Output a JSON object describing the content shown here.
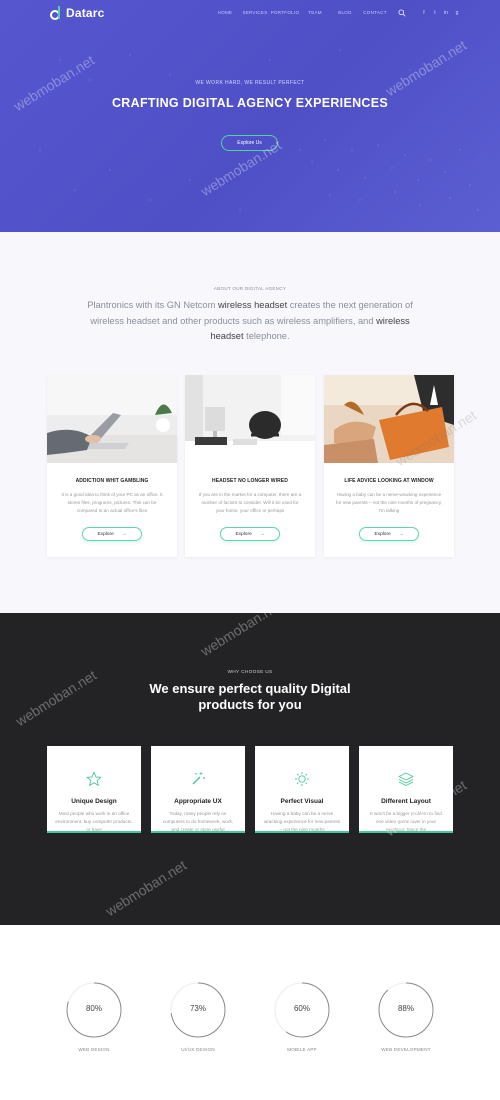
{
  "brand": {
    "name": "Datarc"
  },
  "nav": {
    "items": [
      "HOME",
      "SERVICES",
      "PORTFOLIO",
      "TEAM",
      "BLOG",
      "CONTACT"
    ]
  },
  "social": [
    "f",
    "t",
    "in",
    "g"
  ],
  "hero": {
    "kicker": "WE WORK HARD, WE RESULT PERFECT",
    "title": "CRAFTING DIGITAL AGENCY EXPERIENCES",
    "button": "Explore Us"
  },
  "about": {
    "kicker": "ABOUT OUR DIGITAL AGENCY",
    "text_parts": [
      "Plantronics with its GN Netcom ",
      "wireless headset",
      " creates the next generation of wireless headset and other products such as wireless amplifiers, and ",
      "wireless headset",
      " telephone."
    ],
    "cards": [
      {
        "title": "ADDICTION WHIT GAMBLING",
        "text": "It is a good idea to think of your PC as an office. It stores files, programs, pictures. This can be compared to an actual office's files",
        "button": "Explore"
      },
      {
        "title": "HEADSET NO LONGER WIRED",
        "text": "If you are in the market for a computer, there are a number of factors to consider. Will it be used for your home, your office or perhaps",
        "button": "Explore"
      },
      {
        "title": "LIFE ADVICE LOOKING AT WINDOW",
        "text": "Having a baby can be a nerve-wracking experience for new parents – not the nine months of pregnancy, I'm talking",
        "button": "Explore"
      }
    ]
  },
  "why": {
    "kicker": "WHY CHOOSE US",
    "title_lines": [
      "We ensure perfect quality Digital",
      "products for you"
    ],
    "features": [
      {
        "icon": "star-icon",
        "title": "Unique Design",
        "text": "Most people who work in an office environment, buy computer products, or have"
      },
      {
        "icon": "magic-wand-icon",
        "title": "Appropriate UX",
        "text": "Today, many people rely on computers to do homework, work, and create or store useful"
      },
      {
        "icon": "sun-icon",
        "title": "Perfect Visual",
        "text": "Having a baby can be a nerve wracking experience for new parents – not the nine months"
      },
      {
        "icon": "layers-icon",
        "title": "Different Layout",
        "text": "It won't be a bigger problem to find one video game lover in your neighbor. Since the"
      }
    ]
  },
  "stats": [
    {
      "value": "80%",
      "percent": 80,
      "label": "WEB DESIGN"
    },
    {
      "value": "73%",
      "percent": 73,
      "label": "UI/UX DESIGN"
    },
    {
      "value": "60%",
      "percent": 60,
      "label": "MOBILE APP"
    },
    {
      "value": "88%",
      "percent": 88,
      "label": "WEB DEVELOPMENT"
    }
  ],
  "colors": {
    "hero": "#5555cd",
    "accent": "#53d1a5",
    "dark": "#232325"
  },
  "watermark": "webmoban.net"
}
